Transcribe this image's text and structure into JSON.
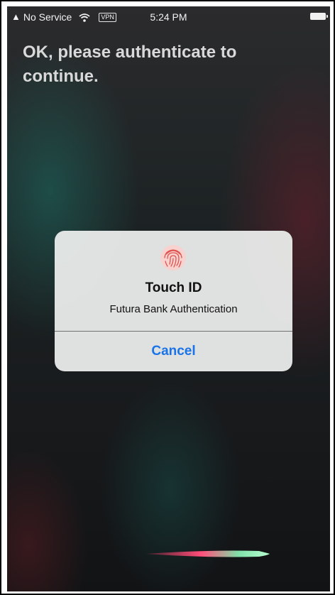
{
  "status_bar": {
    "carrier": "No Service",
    "vpn": "VPN",
    "time": "5:24 PM",
    "icons": [
      "warning-icon",
      "wifi-icon",
      "battery-icon"
    ]
  },
  "siri": {
    "prompt": "OK, please authenticate to continue."
  },
  "alert": {
    "icon": "fingerprint-icon",
    "title": "Touch ID",
    "message": "Futura Bank Authentication",
    "cancel_label": "Cancel"
  },
  "colors": {
    "accent": "#1a73e8",
    "alert_background": "#eef0ef",
    "prompt_text": "#d9d9d9",
    "fingerprint": "#e0524e"
  }
}
